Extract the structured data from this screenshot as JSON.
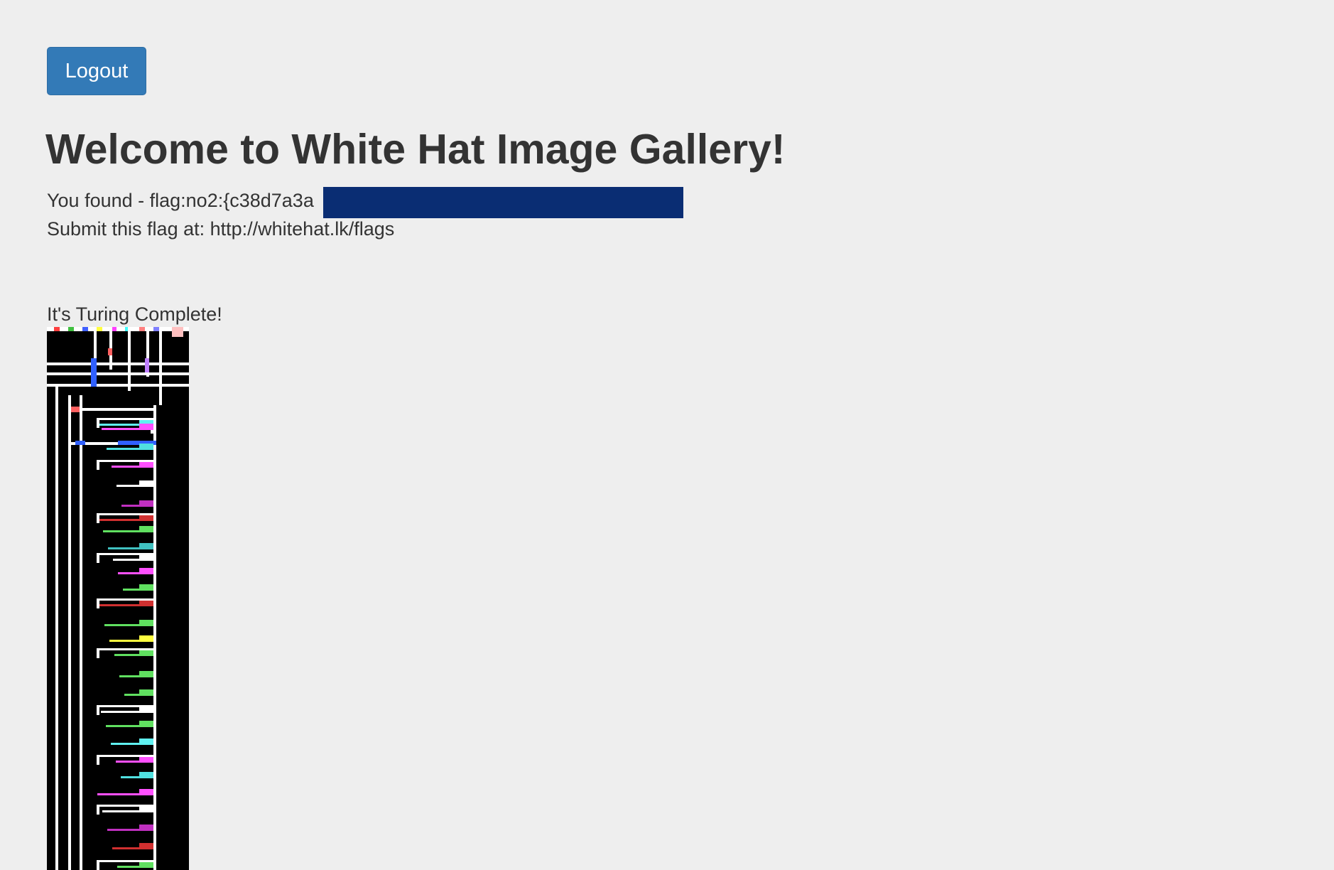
{
  "header": {
    "logout_label": "Logout"
  },
  "main": {
    "title": "Welcome to White Hat Image Gallery!",
    "flag_text": "You found - flag:no2:{c38d7a3a",
    "submit_text": "Submit this flag at: http://whitehat.lk/flags",
    "image_caption": "It's Turing Complete!"
  },
  "colors": {
    "background": "#eeeeee",
    "button": "#337ab7",
    "text": "#333333",
    "redaction": "#0a2d73"
  },
  "image": {
    "description_icon": "piet-program-image"
  }
}
